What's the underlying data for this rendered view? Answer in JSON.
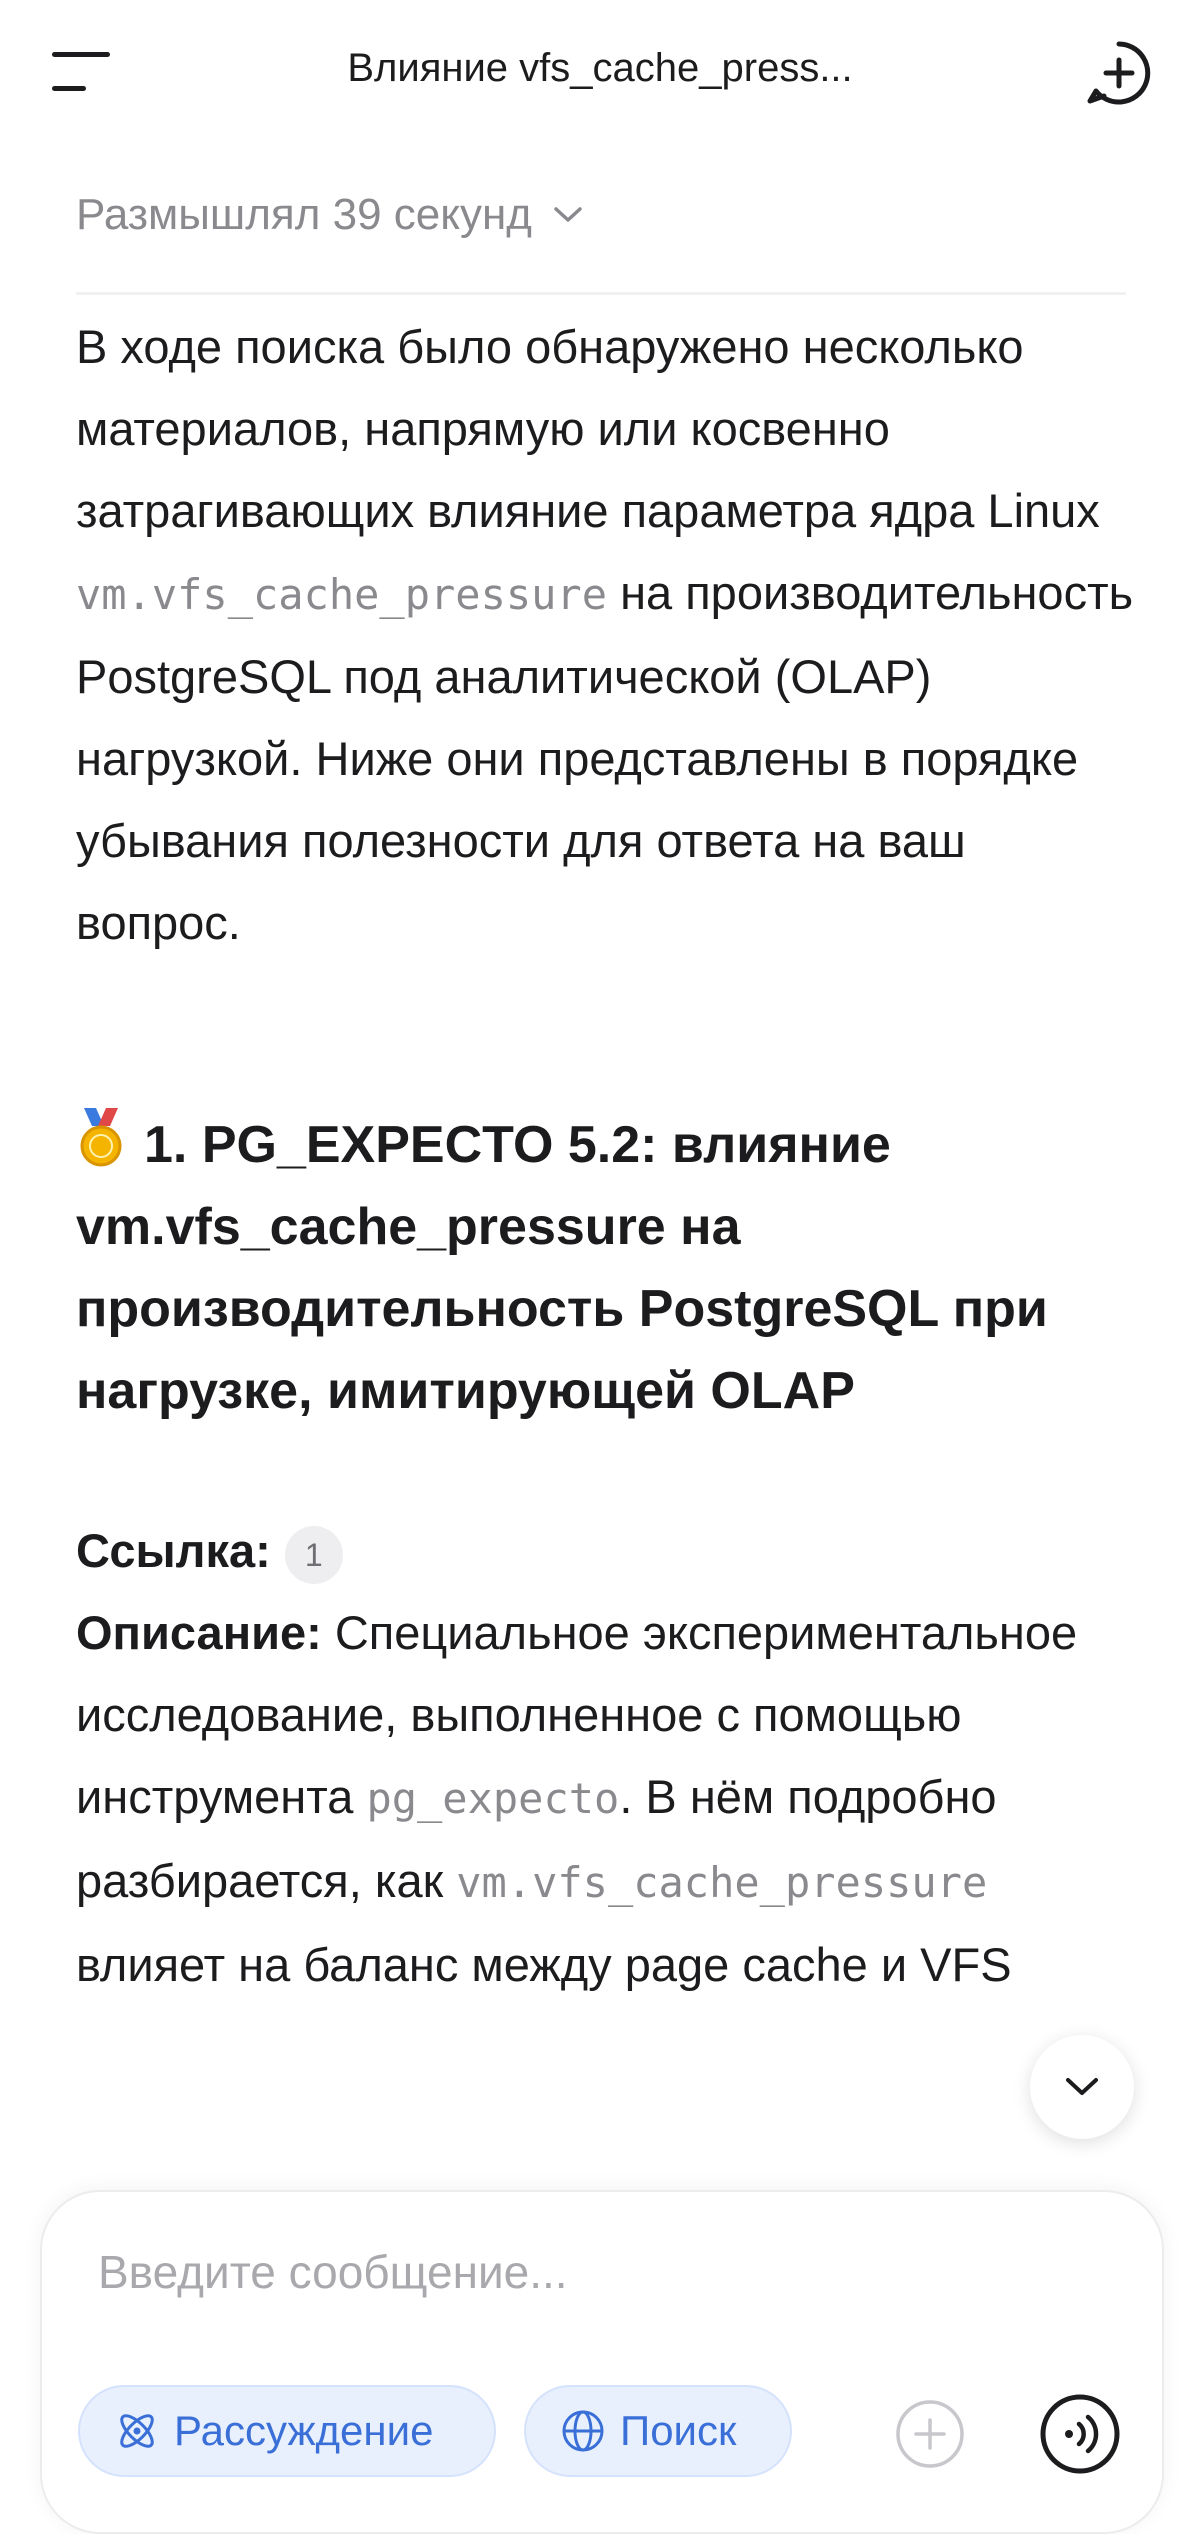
{
  "header": {
    "title": "Влияние vfs_cache_press...",
    "menu_icon": "menu-icon",
    "new_chat_icon": "new-chat-icon"
  },
  "thinking": {
    "label": "Размышлял 39 секунд"
  },
  "intro": {
    "part1": "В ходе поиска было обнаружено несколько материалов, напрямую или косвенно затрагивающих влияние параметра ядра Linux ",
    "code": "vm.vfs_cache_pressure",
    "part2": " на производительность PostgreSQL под аналитической (OLAP) нагрузкой. Ниже они представлены в порядке убывания полезности для ответа на ваш вопрос."
  },
  "section1": {
    "heading": "1. PG_EXPECTO 5.2: влияние vm.vfs_cache_pressure на производительность PostgreSQL при нагрузке, имитирующей OLAP",
    "link_label": "Ссылка:",
    "link_ref": "1",
    "desc_label": "Описание:",
    "desc_part1": " Специальное экспериментальное исследование, выполненное с помощью инструмента ",
    "desc_code1": "pg_expecto",
    "desc_part2": ". В нём подробно разбирается, как ",
    "desc_code2": "vm.vfs_cache_pressure",
    "desc_part3": " влияет на баланс между page cache и VFS"
  },
  "composer": {
    "placeholder": "Введите сообщение...",
    "reasoning_label": "Рассуждение",
    "search_label": "Поиск"
  },
  "colors": {
    "accent": "#3a6fd8",
    "pill_bg": "#e8f0fd",
    "muted_text": "#8a8a8e"
  }
}
